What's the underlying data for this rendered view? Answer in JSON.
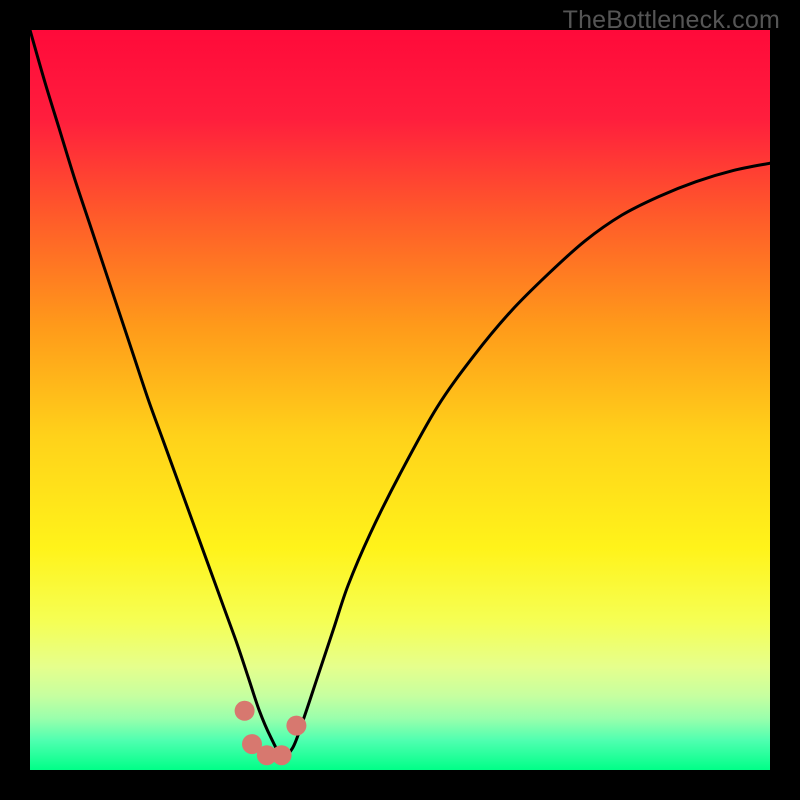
{
  "watermark": "TheBottleneck.com",
  "chart_data": {
    "type": "line",
    "title": "",
    "xlabel": "",
    "ylabel": "",
    "xlim": [
      0,
      100
    ],
    "ylim": [
      0,
      100
    ],
    "grid": false,
    "legend": false,
    "background": {
      "type": "vertical-gradient",
      "stops": [
        {
          "pos": 0.0,
          "color": "#ff0a3a"
        },
        {
          "pos": 0.12,
          "color": "#ff1e3d"
        },
        {
          "pos": 0.25,
          "color": "#ff5a2a"
        },
        {
          "pos": 0.4,
          "color": "#ff9a1a"
        },
        {
          "pos": 0.55,
          "color": "#ffd21a"
        },
        {
          "pos": 0.7,
          "color": "#fff31a"
        },
        {
          "pos": 0.8,
          "color": "#f5ff55"
        },
        {
          "pos": 0.86,
          "color": "#e6ff8c"
        },
        {
          "pos": 0.9,
          "color": "#c6ffa0"
        },
        {
          "pos": 0.93,
          "color": "#9affac"
        },
        {
          "pos": 0.96,
          "color": "#4fffb0"
        },
        {
          "pos": 1.0,
          "color": "#00ff88"
        }
      ]
    },
    "series": [
      {
        "name": "curve",
        "color": "#000000",
        "stroke_width": 3,
        "x": [
          0,
          2,
          4,
          6,
          8,
          10,
          12,
          14,
          16,
          18,
          20,
          22,
          24,
          26,
          28,
          29.5,
          31,
          32.5,
          34,
          35.5,
          37,
          39,
          41,
          43,
          46,
          50,
          55,
          60,
          65,
          70,
          75,
          80,
          85,
          90,
          95,
          100
        ],
        "y": [
          100,
          93,
          86.5,
          80,
          74,
          68,
          62,
          56,
          50,
          44.5,
          39,
          33.5,
          28,
          22.5,
          17,
          12.5,
          8,
          4.5,
          2,
          3,
          7,
          13,
          19,
          25,
          32,
          40,
          49,
          56,
          62,
          67,
          71.5,
          75,
          77.5,
          79.5,
          81,
          82
        ]
      }
    ],
    "markers": [
      {
        "x": 29.0,
        "y": 8.0,
        "r": 10,
        "color": "#d7786f"
      },
      {
        "x": 30.0,
        "y": 3.5,
        "r": 10,
        "color": "#d7786f"
      },
      {
        "x": 32.0,
        "y": 2.0,
        "r": 10,
        "color": "#d7786f"
      },
      {
        "x": 34.0,
        "y": 2.0,
        "r": 10,
        "color": "#d7786f"
      },
      {
        "x": 36.0,
        "y": 6.0,
        "r": 10,
        "color": "#d7786f"
      }
    ]
  }
}
